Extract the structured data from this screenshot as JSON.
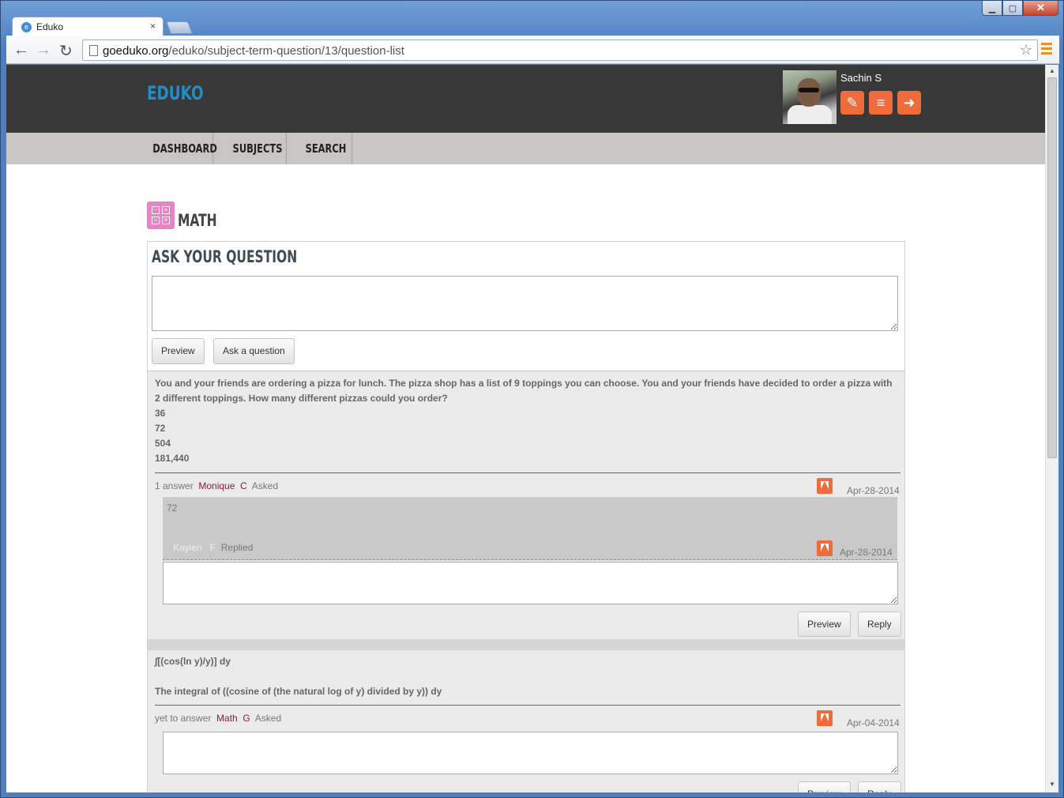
{
  "browser": {
    "tab_title": "Eduko",
    "tab_close": "×",
    "url_host": "goeduko.org",
    "url_path": "/eduko/subject-term-question/13/question-list",
    "back_glyph": "←",
    "forward_glyph": "→",
    "reload_glyph": "↻",
    "star_glyph": "☆",
    "minimize_glyph": "▁",
    "maximize_glyph": "▢",
    "close_glyph": "✕",
    "favicon_glyph": "e"
  },
  "header": {
    "logo": "EDUKO",
    "user_name": "Sachin  S",
    "icons": [
      {
        "name": "profile-edit-icon",
        "glyph": "✎"
      },
      {
        "name": "books-icon",
        "glyph": "≡"
      },
      {
        "name": "logout-icon",
        "glyph": "➜"
      }
    ],
    "icon_color": "#ee6b3b"
  },
  "nav": {
    "items": [
      {
        "label": "DASHBOARD"
      },
      {
        "label": "SUBJECTS"
      },
      {
        "label": "SEARCH"
      }
    ]
  },
  "subject": {
    "title": "MATH",
    "icon_color": "#e784c3",
    "icon_glyphs": [
      "−",
      "+",
      "÷",
      "×"
    ]
  },
  "ask": {
    "title": "ASK YOUR QUESTION",
    "input_value": "",
    "preview_label": "Preview",
    "submit_label": "Ask a question"
  },
  "questions": [
    {
      "lines": [
        "You and your friends are ordering a pizza for lunch. The pizza shop has a list of 9 toppings you can choose. You and your friends have decided to order a pizza with 2 different toppings. How many different pizzas could you order?",
        "36",
        "72",
        "504",
        "181,440"
      ],
      "answer_count": "1 answer",
      "asker_first": "Monique",
      "asker_last": "C",
      "asked_label": "Asked",
      "date": "Apr-28-2014",
      "answers": [
        {
          "value": "72",
          "user_first": "Kaylen",
          "user_last": "F",
          "replied_label": "Replied",
          "date": "Apr-28-2014"
        }
      ],
      "preview_label": "Preview",
      "reply_label": "Reply"
    },
    {
      "lines": [
        "∫[(cos(ln y)/y)] dy",
        "",
        "The integral of ((cosine of (the natural log of y) divided by y)) dy"
      ],
      "answer_count": "yet to answer",
      "asker_first": "Math",
      "asker_last": "G",
      "asked_label": "Asked",
      "date": "Apr-04-2014",
      "preview_label": "Preview",
      "reply_label": "Reply"
    }
  ]
}
